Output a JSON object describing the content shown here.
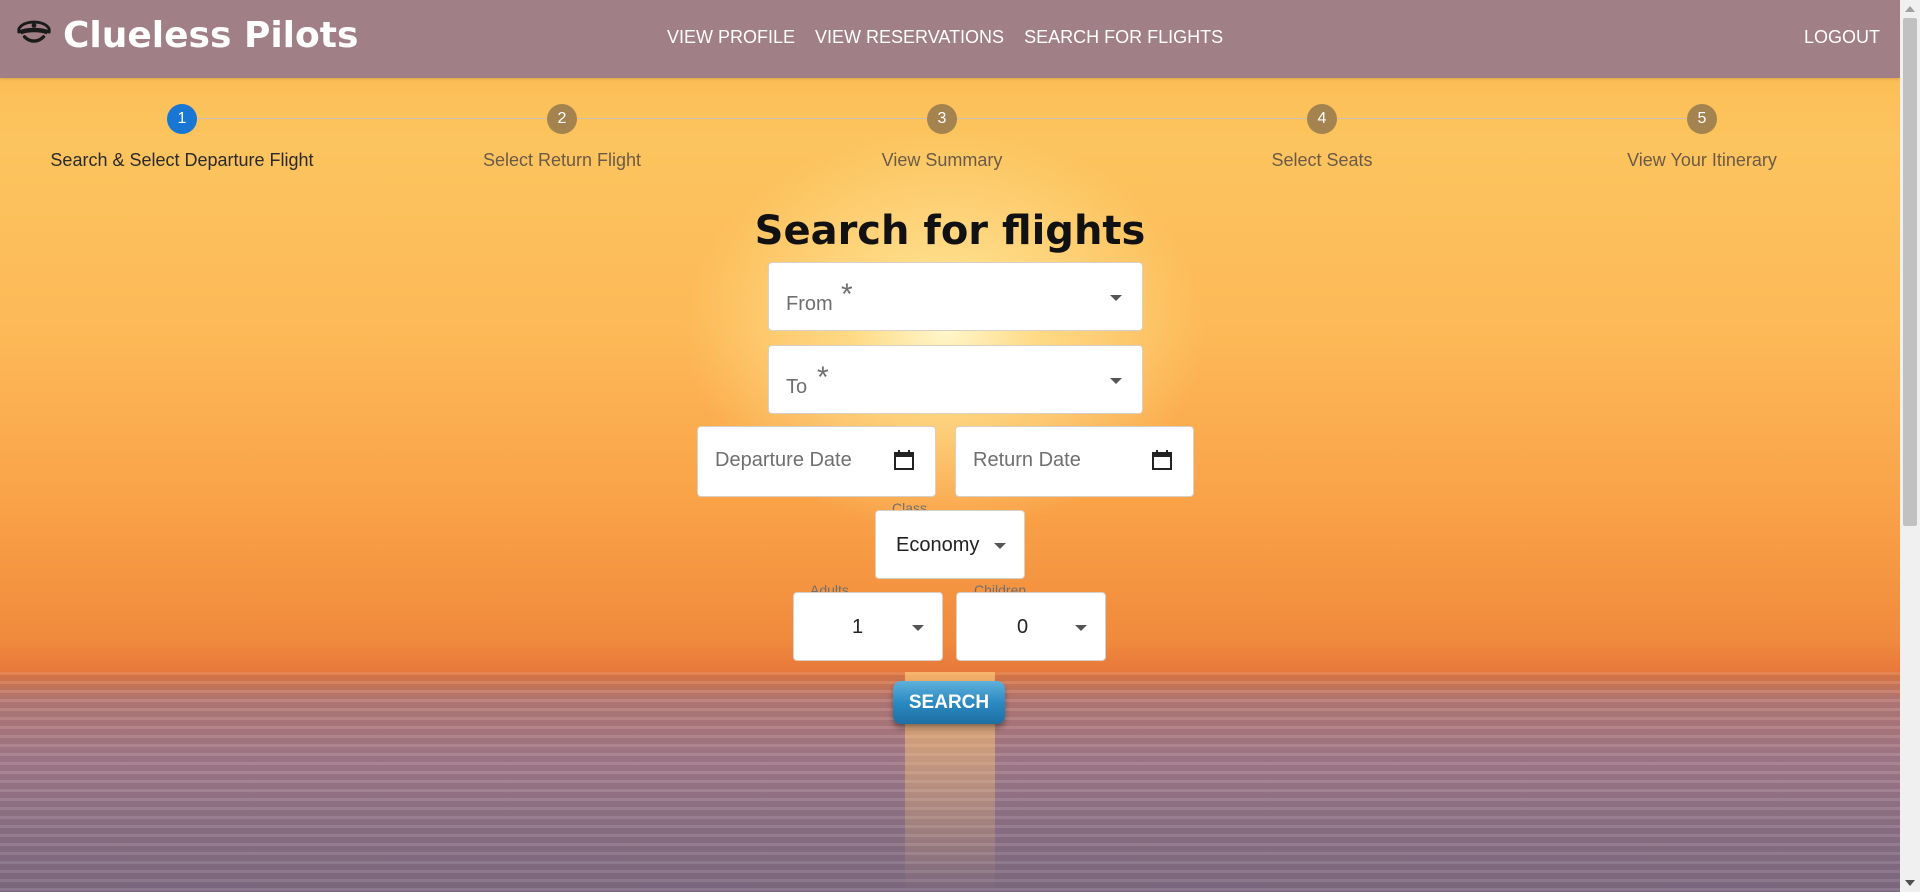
{
  "app": {
    "title": "Clueless Pilots",
    "logo_icon": "pilot-cap-icon"
  },
  "nav": {
    "items": [
      "VIEW PROFILE",
      "VIEW RESERVATIONS",
      "SEARCH FOR FLIGHTS"
    ],
    "logout": "LOGOUT"
  },
  "stepper": {
    "steps": [
      {
        "number": "1",
        "label": "Search & Select Departure Flight",
        "active": true
      },
      {
        "number": "2",
        "label": "Select Return Flight",
        "active": false
      },
      {
        "number": "3",
        "label": "View Summary",
        "active": false
      },
      {
        "number": "4",
        "label": "Select Seats",
        "active": false
      },
      {
        "number": "5",
        "label": "View Your Itinerary",
        "active": false
      }
    ],
    "active_color": "#1976d2",
    "inactive_color": "#a5834f"
  },
  "form": {
    "title": "Search for flights",
    "from_label": "From",
    "to_label": "To",
    "required_mark": "*",
    "departure_placeholder": "Departure Date",
    "return_placeholder": "Return Date",
    "class_label": "Class",
    "class_value": "Economy",
    "adults_label": "Adults",
    "adults_value": "1",
    "children_label": "Children",
    "children_value": "0",
    "search_button": "SEARCH"
  },
  "colors": {
    "header_bg": "#a17f86",
    "button_blue": "#2b8ac2"
  }
}
